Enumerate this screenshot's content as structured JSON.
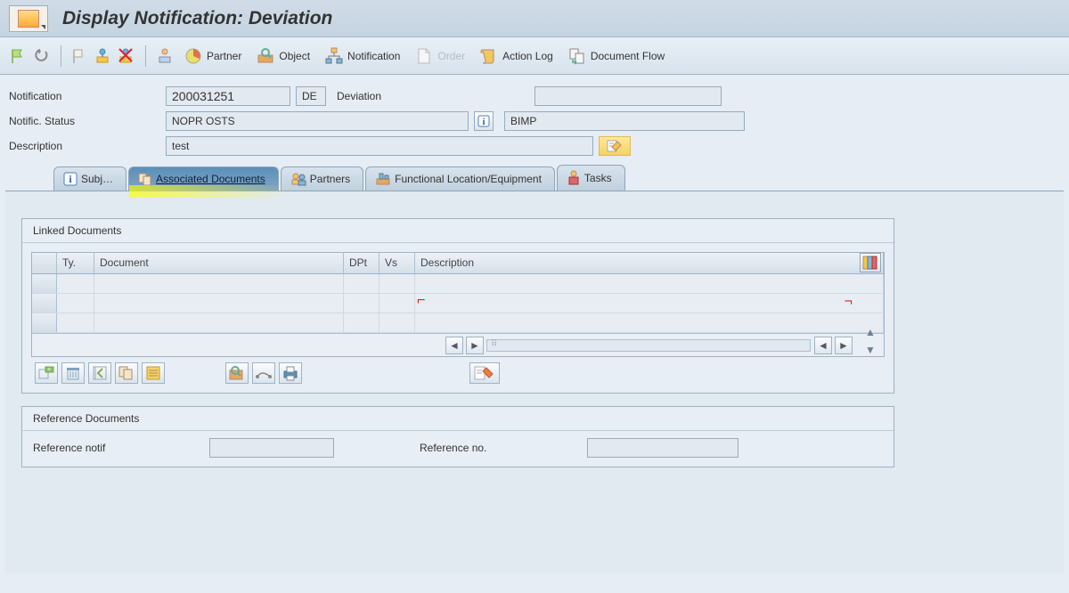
{
  "title": "Display Notification: Deviation",
  "toolbar": {
    "partner": "Partner",
    "object": "Object",
    "notification": "Notification",
    "order": "Order",
    "action_log": "Action Log",
    "document_flow": "Document Flow"
  },
  "header": {
    "notification_label": "Notification",
    "notification_value": "200031251",
    "type_code": "DE",
    "type_text": "Deviation",
    "status_label": "Notific. Status",
    "status_value": "NOPR OSTS",
    "status2_value": "BIMP",
    "description_label": "Description",
    "description_value": "test"
  },
  "tabs": {
    "subj": "Subj…",
    "assoc": "Associated Documents",
    "partners": "Partners",
    "funcloc": "Functional Location/Equipment",
    "tasks": "Tasks"
  },
  "linked": {
    "group_title": "Linked Documents",
    "cols": {
      "ty": "Ty.",
      "doc": "Document",
      "dpt": "DPt",
      "vs": "Vs",
      "desc": "Description"
    }
  },
  "reference": {
    "group_title": "Reference Documents",
    "notif_label": "Reference notif",
    "notif_value": "",
    "no_label": "Reference no.",
    "no_value": ""
  }
}
